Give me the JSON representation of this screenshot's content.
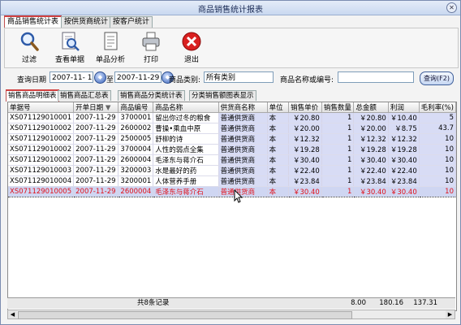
{
  "window": {
    "title": "商品销售统计报表",
    "close_glyph": "✕"
  },
  "tabs": [
    "商品销售统计表",
    "按供货商统计",
    "按客户统计"
  ],
  "toolbar": {
    "items": [
      {
        "label": "过滤",
        "icon": "magnifier-icon"
      },
      {
        "label": "查看单据",
        "icon": "view-document-icon"
      },
      {
        "label": "单品分析",
        "icon": "document-icon"
      },
      {
        "label": "打印",
        "icon": "printer-icon"
      },
      {
        "label": "退出",
        "icon": "exit-icon"
      }
    ]
  },
  "filter": {
    "date_label": "查询日期",
    "date_from": "2007-11- 1",
    "to_label": "至",
    "date_to": "2007-11-29",
    "category_label": "商品类别:",
    "category_value": "所有类别",
    "name_label": "商品名称或编号:",
    "name_value": "",
    "query_button": "查询(F2)"
  },
  "subtabs": [
    "销售商品明细表",
    "销售商品汇总表",
    "销售商品分类统计表",
    "分类销售额图表显示"
  ],
  "table": {
    "columns": [
      "单据号",
      "开单日期",
      "商品编号",
      "商品名称",
      "供货商名称",
      "单位",
      "销售单价",
      "销售数量",
      "总金额",
      "利润",
      "毛利率(%)"
    ],
    "rows": [
      [
        "XS071129010001",
        "2007-11-29",
        "3700001",
        "留出你过冬的粮食",
        "普通供货商",
        "本",
        "￥20.80",
        "1",
        "￥20.80",
        "￥10.40",
        "5"
      ],
      [
        "XS071129010002",
        "2007-11-29",
        "2600002",
        "曹操•乘血中原",
        "普通供货商",
        "本",
        "￥20.00",
        "1",
        "￥20.00",
        "￥8.75",
        "43.7"
      ],
      [
        "XS071129010002",
        "2007-11-29",
        "2500005",
        "舒柳的诗",
        "普通供货商",
        "本",
        "￥12.32",
        "1",
        "￥12.32",
        "￥12.32",
        "10"
      ],
      [
        "XS071129010002",
        "2007-11-29",
        "3700004",
        "人性的弱点全集",
        "普通供货商",
        "本",
        "￥19.28",
        "1",
        "￥19.28",
        "￥19.28",
        "10"
      ],
      [
        "XS071129010002",
        "2007-11-29",
        "2600004",
        "毛泽东与蒋介石",
        "普通供货商",
        "本",
        "￥30.40",
        "1",
        "￥30.40",
        "￥30.40",
        "10"
      ],
      [
        "XS071129010003",
        "2007-11-29",
        "3200003",
        "水是最好的药",
        "普通供货商",
        "本",
        "￥22.40",
        "1",
        "￥22.40",
        "￥22.40",
        "10"
      ],
      [
        "XS071129010004",
        "2007-11-29",
        "3200001",
        "人体营养手册",
        "普通供货商",
        "本",
        "￥23.84",
        "1",
        "￥23.84",
        "￥23.84",
        "10"
      ],
      [
        "XS071129010005",
        "2007-11-29",
        "2600004",
        "毛泽东与蒋介石",
        "普通供货商",
        "本",
        "￥30.40",
        "1",
        "￥30.40",
        "￥30.40",
        "10"
      ]
    ],
    "selected_row": 7
  },
  "footer": {
    "record_count": "共8条记录",
    "total_qty": "8.00",
    "total_amount": "180.16",
    "total_profit": "137.31"
  },
  "colors": {
    "selected_text": "#e0101a",
    "accent": "#d04040"
  }
}
